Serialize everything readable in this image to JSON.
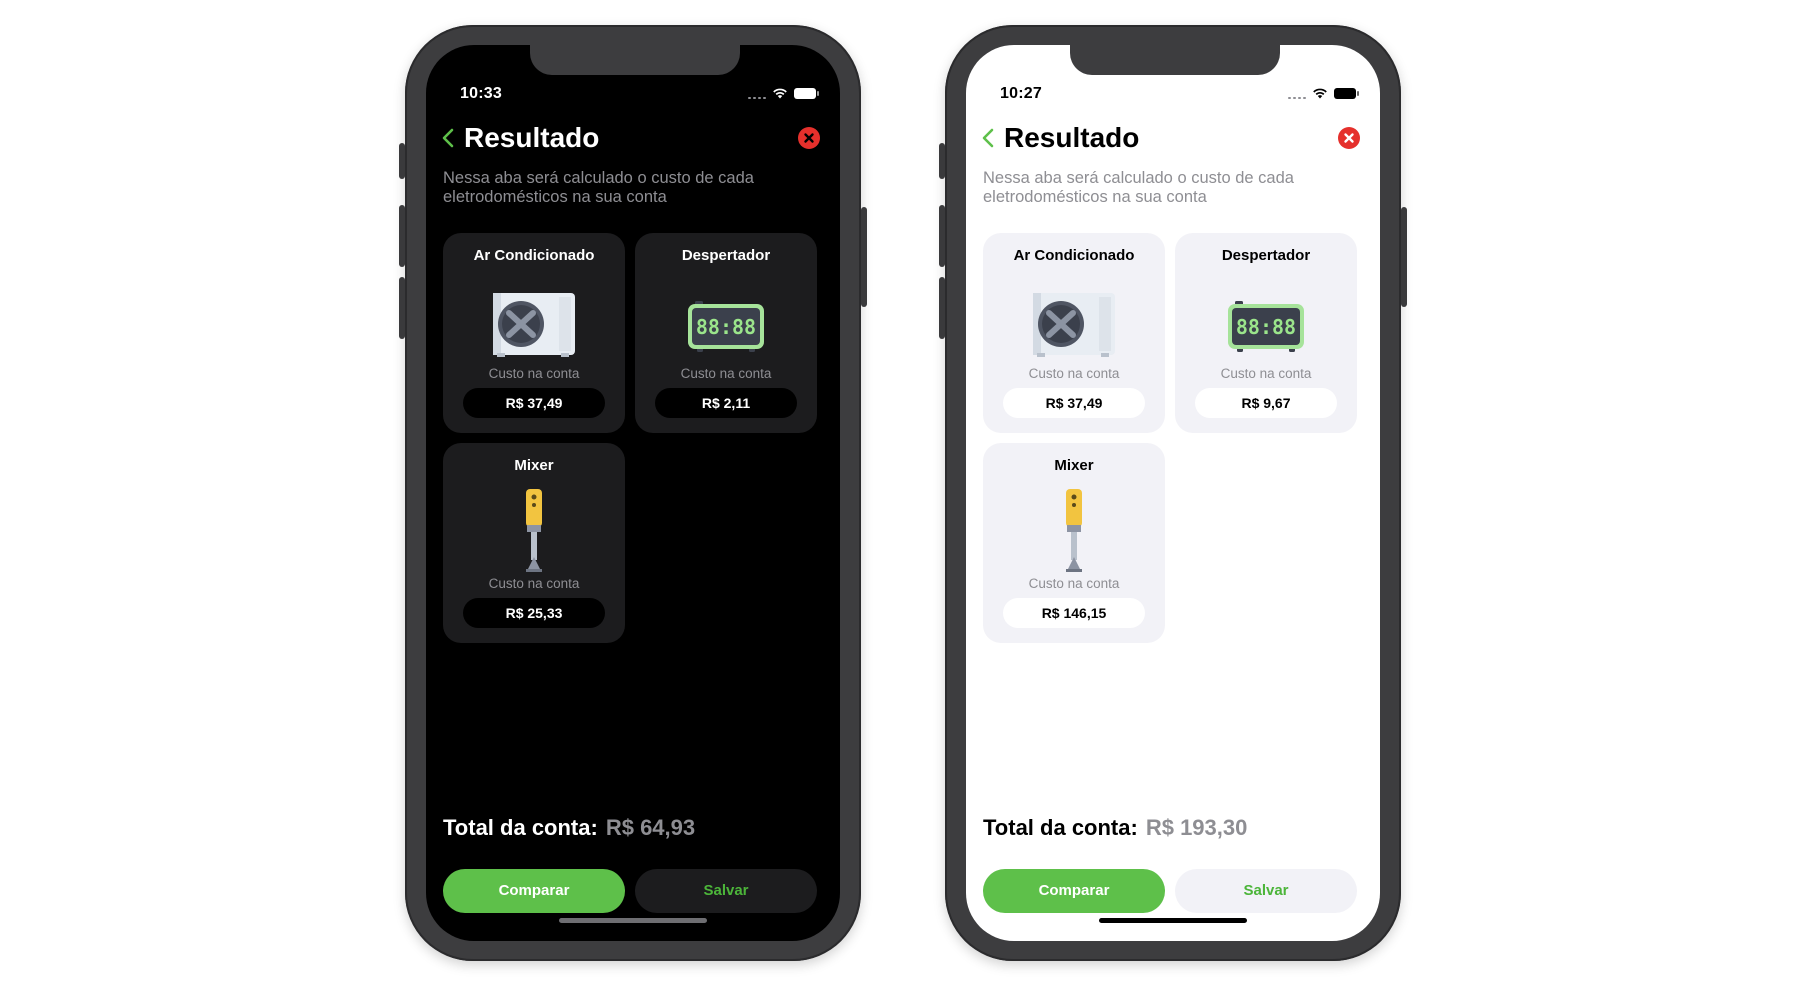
{
  "colors": {
    "accent_green": "#5ec04a",
    "close_red": "#e5302c",
    "muted_gray": "#8e8e93"
  },
  "phones": [
    {
      "theme": "dark",
      "status": {
        "time": "10:33",
        "icons": [
          "signal-dots-icon",
          "wifi-icon",
          "battery-icon"
        ]
      },
      "header": {
        "back_icon": "chevron-left-icon",
        "title": "Resultado",
        "close_icon": "close-icon"
      },
      "subtitle": "Nessa aba será calculado o custo de cada eletrodomésticos na sua conta",
      "cards": [
        {
          "title": "Ar Condicionado",
          "icon": "air-conditioner-icon",
          "caption": "Custo na conta",
          "value": "R$ 37,49"
        },
        {
          "title": "Despertador",
          "icon": "alarm-clock-icon",
          "caption": "Custo na conta",
          "value": "R$ 2,11"
        },
        {
          "title": "Mixer",
          "icon": "mixer-icon",
          "caption": "Custo na conta",
          "value": "R$ 25,33"
        }
      ],
      "total": {
        "label": "Total da conta:",
        "value": "R$ 64,93"
      },
      "buttons": {
        "compare": "Comparar",
        "save": "Salvar"
      },
      "clock_display": "88:88"
    },
    {
      "theme": "light",
      "status": {
        "time": "10:27",
        "icons": [
          "signal-dots-icon",
          "wifi-icon",
          "battery-icon"
        ]
      },
      "header": {
        "back_icon": "chevron-left-icon",
        "title": "Resultado",
        "close_icon": "close-icon"
      },
      "subtitle": "Nessa aba será calculado o custo de cada eletrodomésticos na sua conta",
      "cards": [
        {
          "title": "Ar Condicionado",
          "icon": "air-conditioner-icon",
          "caption": "Custo na conta",
          "value": "R$ 37,49"
        },
        {
          "title": "Despertador",
          "icon": "alarm-clock-icon",
          "caption": "Custo na conta",
          "value": "R$ 9,67"
        },
        {
          "title": "Mixer",
          "icon": "mixer-icon",
          "caption": "Custo na conta",
          "value": "R$ 146,15"
        }
      ],
      "total": {
        "label": "Total da conta:",
        "value": "R$ 193,30"
      },
      "buttons": {
        "compare": "Comparar",
        "save": "Salvar"
      },
      "clock_display": "88:88"
    }
  ]
}
